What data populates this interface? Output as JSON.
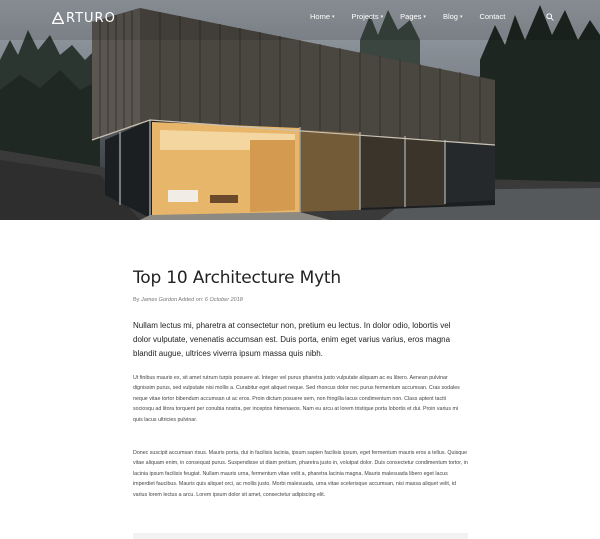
{
  "brand": {
    "logo_text": "RTURO",
    "logo_mark": "A-triangle-icon"
  },
  "nav": {
    "items": [
      {
        "label": "Home",
        "has_dropdown": true
      },
      {
        "label": "Projects",
        "has_dropdown": true
      },
      {
        "label": "Pages",
        "has_dropdown": true
      },
      {
        "label": "Blog",
        "has_dropdown": true
      },
      {
        "label": "Contact",
        "has_dropdown": false
      }
    ],
    "search_icon": "search-icon"
  },
  "hero": {
    "image": "modern-wooden-house-at-dusk"
  },
  "article": {
    "title": "Top 10 Architecture Myth",
    "meta": {
      "by": "By",
      "author": "James Gordon",
      "added_on": "Added on",
      "date": "6 October 2018"
    },
    "lead": "Nullam lectus mi, pharetra at consectetur non, pretium eu lectus. In dolor odio, lobortis vel dolor vulputate, venenatis accumsan est. Duis porta, enim eget varius varius, eros magna blandit augue, ultrices viverra ipsum massa quis nibh.",
    "paragraphs": [
      "Ut finibus mauris ex, sit amet rutrum turpis posuere at. Integer vel purus pharetra justo vulputate aliquam ac eu libero. Aenean pulvinar dignissim purus, sed vulputate nisi mollis a. Curabitur eget aliquet neque. Sed rhoncus dolor nec purus fermentum accumsan. Cras sodales neque vitae tortor bibendum accumsan ut ac eros. Proin dictum posuere sem, non fringilla lacus condimentum non. Class aptent taciti sociosqu ad litora torquent per conubia nostra, per inceptos himenaeos. Nam eu arcu at lorem tristique porta lobortis et dui. Proin varius mi quis lacus ultricies pulvinar.",
      "Donec suscipit accumsan risus. Mauris porta, dui in facilisis lacinia, ipsum sapien facilisis ipsum, eget fermentum mauris eros a tellus. Quisque vitae aliquam enim, in consequat purus. Suspendisse ut diam pretium, pharetra justo in, volutpat dolor. Duis consectetur condimentum tortor, in lacinia ipsum facilisis feugiat. Nullam mauris urna, fermentum vitae velit a, pharetra lacinia magna. Mauris malesuada libero eget lacus imperdiet faucibus. Mauris quis aliquet orci, ac mollis justo. Morbi malesuada, urna vitae scelerisque accumsan, nisi massa aliquet velit, id varius lorem lectus a arcu. Lorem ipsum dolor sit amet, consectetur adipiscing elit."
    ]
  }
}
